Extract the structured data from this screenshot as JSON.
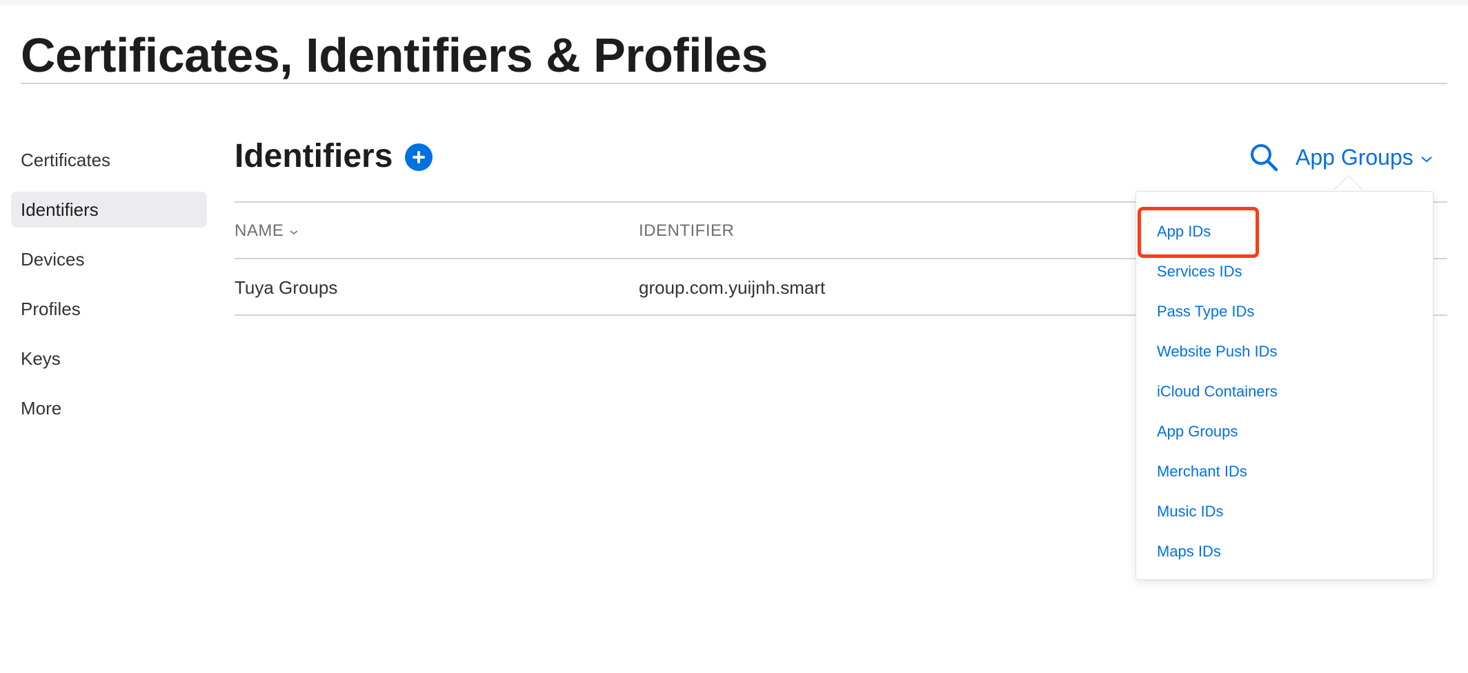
{
  "header": {
    "title": "Certificates, Identifiers & Profiles"
  },
  "sidebar": {
    "items": [
      {
        "label": "Certificates",
        "active": false
      },
      {
        "label": "Identifiers",
        "active": true
      },
      {
        "label": "Devices",
        "active": false
      },
      {
        "label": "Profiles",
        "active": false
      },
      {
        "label": "Keys",
        "active": false
      },
      {
        "label": "More",
        "active": false
      }
    ]
  },
  "main": {
    "title": "Identifiers",
    "add_icon": "plus-circle-icon",
    "search_icon": "search-icon",
    "filter_label": "App Groups",
    "filter_icon": "chevron-down-icon"
  },
  "table": {
    "columns": [
      {
        "label": "NAME",
        "sortable": true
      },
      {
        "label": "IDENTIFIER",
        "sortable": false
      }
    ],
    "rows": [
      {
        "name": "Tuya Groups",
        "identifier": "group.com.yuijnh.smart"
      }
    ]
  },
  "dropdown": {
    "items": [
      "App IDs",
      "Services IDs",
      "Pass Type IDs",
      "Website Push IDs",
      "iCloud Containers",
      "App Groups",
      "Merchant IDs",
      "Music IDs",
      "Maps IDs"
    ],
    "highlighted_item": "App IDs"
  },
  "colors": {
    "accent": "#0071e3",
    "highlight": "#ff3b14",
    "text": "#1d1d1f",
    "muted": "#6e6e73",
    "divider": "#d2d2d7",
    "active_bg": "#ececee"
  }
}
